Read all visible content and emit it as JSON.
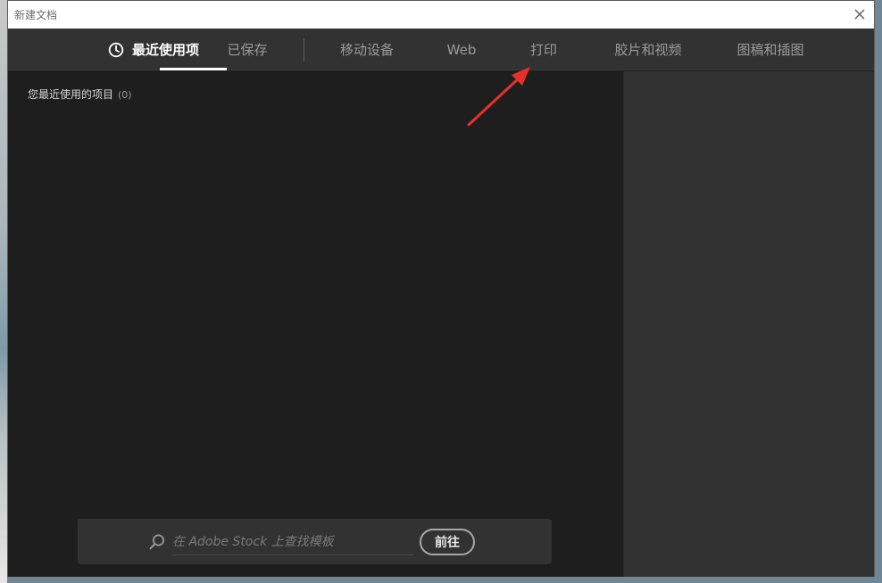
{
  "window": {
    "title": "新建文档"
  },
  "tabs": [
    {
      "label": "最近使用项",
      "active": true
    },
    {
      "label": "已保存"
    },
    {
      "label": "移动设备"
    },
    {
      "label": "Web"
    },
    {
      "label": "打印"
    },
    {
      "label": "胶片和视频"
    },
    {
      "label": "图稿和插图"
    }
  ],
  "recent": {
    "heading": "您最近使用的项目",
    "count": "(0)"
  },
  "search": {
    "placeholder": "在 Adobe Stock 上查找模板",
    "button_label": "前往"
  },
  "icons": {
    "close": "close-icon",
    "clock": "clock-icon",
    "search": "search-icon",
    "annotation": "red-arrow-annotation"
  },
  "colors": {
    "annotation_arrow": "#e8302a",
    "window_bg": "#1e1e1e",
    "panel_bg": "#323232"
  }
}
